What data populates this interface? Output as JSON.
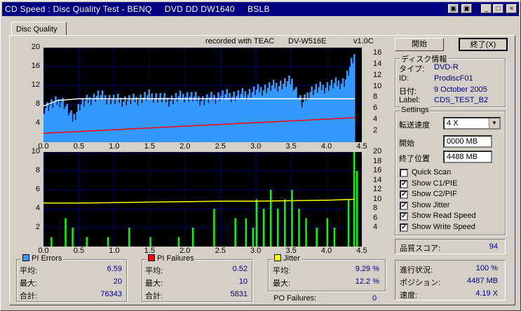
{
  "window": {
    "title": "CD Speed : Disc Quality Test - BENQ     DVD DD DW1640     BSLB",
    "title_buttons": [
      "▣",
      "▣",
      "_",
      "□",
      "×"
    ]
  },
  "tab": {
    "label": "Disc Quality"
  },
  "header": {
    "recorded": "recorded with TEAC",
    "drive": "DV-W516E",
    "version": "v1.0C"
  },
  "buttons": {
    "start": "開始",
    "exit": "終了(X)"
  },
  "disc_info": {
    "title": "ディスク情報",
    "type_label": "タイプ:",
    "type_value": "DVD-R",
    "id_label": "ID:",
    "id_value": "ProdiscF01",
    "date_label": "日付:",
    "date_value": "9 October 2005",
    "label_label": "Label:",
    "label_value": "CDS_TEST_B2"
  },
  "settings": {
    "title": "Settings",
    "speed_label": "転送速度",
    "speed_value": "4 X",
    "start_label": "開始",
    "start_value": "0000 MB",
    "end_label": "終了位置",
    "end_value": "4488 MB",
    "options": [
      {
        "label": "Quick Scan",
        "checked": false
      },
      {
        "label": "Show C1/PIE",
        "checked": true
      },
      {
        "label": "Show C2/PIF",
        "checked": true
      },
      {
        "label": "Show Jitter",
        "checked": true
      },
      {
        "label": "Show Read Speed",
        "checked": true
      },
      {
        "label": "Show Write Speed",
        "checked": true
      }
    ]
  },
  "quality": {
    "label": "品質スコア:",
    "value": "94"
  },
  "progress": {
    "status_label": "進行状況:",
    "status_value": "100 %",
    "position_label": "ポジション:",
    "position_value": "4487 MB",
    "speed_label": "速度:",
    "speed_value": "4.19 X"
  },
  "pi_errors": {
    "title": "PI Errors",
    "color": "#3399ff",
    "avg_label": "平均:",
    "avg": "6.59",
    "max_label": "最大:",
    "max": "20",
    "total_label": "合計:",
    "total": "76343"
  },
  "pi_failures": {
    "title": "PI Failures",
    "color": "#ff0000",
    "avg_label": "平均:",
    "avg": "0.52",
    "max_label": "最大:",
    "max": "10",
    "total_label": "合計:",
    "total": "5831"
  },
  "jitter": {
    "title": "Jitter",
    "color": "#ffff00",
    "avg_label": "平均:",
    "avg": "9.29 %",
    "max_label": "最大:",
    "max": "12.2 %"
  },
  "po_failures": {
    "label": "PO Failures:",
    "value": "0"
  },
  "chart_data": [
    {
      "type": "bar",
      "title": "",
      "x_ticks": [
        "0.0",
        "0.5",
        "1.0",
        "1.5",
        "2.0",
        "2.5",
        "3.0",
        "3.5",
        "4.0",
        "4.5"
      ],
      "xlim": [
        0,
        4.5
      ],
      "y_left_ticks": [
        "20",
        "16",
        "12",
        "8",
        "4"
      ],
      "ylim_left": [
        0,
        20
      ],
      "y_right_ticks": [
        "16",
        "14",
        "12",
        "10",
        "8",
        "6",
        "4",
        "2"
      ],
      "ylim_right": [
        0,
        17
      ],
      "series": [
        {
          "name": "PI Errors",
          "color": "#3399ff",
          "x": [
            0.0,
            0.25,
            0.4,
            0.5,
            0.75,
            1.0,
            1.25,
            1.5,
            1.75,
            2.0,
            2.25,
            2.5,
            2.75,
            3.0,
            3.25,
            3.5,
            3.65,
            3.75,
            4.0,
            4.25,
            4.4
          ],
          "values": [
            7.5,
            9,
            5,
            8,
            10,
            9,
            9,
            10,
            9,
            10,
            9,
            10,
            10,
            11,
            12,
            13,
            8,
            11,
            12,
            13,
            19
          ]
        },
        {
          "name": "Read Speed",
          "color": "#ffffff",
          "x": [
            0.0,
            0.1,
            0.2,
            0.5,
            1.0,
            1.5,
            2.0,
            2.5,
            3.0,
            3.5,
            4.0,
            4.4
          ],
          "values": [
            6.5,
            7,
            7.5,
            7.8,
            7.8,
            7.8,
            7.8,
            7.8,
            7.8,
            7.8,
            7.8,
            7.8
          ]
        },
        {
          "name": "Write Speed",
          "color": "#ff0000",
          "x": [
            0.0,
            4.4
          ],
          "values": [
            1.6,
            4.4
          ]
        }
      ]
    },
    {
      "type": "bar",
      "title": "",
      "x_ticks": [
        "0.0",
        "0.5",
        "1.0",
        "1.5",
        "2.0",
        "2.5",
        "3.0",
        "3.5",
        "4.0",
        "4.5"
      ],
      "xlim": [
        0,
        4.5
      ],
      "y_left_ticks": [
        "10",
        "8",
        "6",
        "4",
        "2"
      ],
      "ylim_left": [
        0,
        10
      ],
      "y_right_ticks": [
        "20",
        "18",
        "16",
        "14",
        "12",
        "10",
        "8",
        "6",
        "4"
      ],
      "ylim_right": [
        0,
        20
      ],
      "series": [
        {
          "name": "PI Failures",
          "color": "#00ff00",
          "x": [
            0.1,
            0.3,
            0.4,
            0.6,
            0.9,
            1.2,
            1.5,
            1.9,
            2.1,
            2.4,
            2.7,
            2.85,
            2.95,
            3.0,
            3.1,
            3.2,
            3.3,
            3.4,
            3.5,
            3.6,
            3.7,
            3.85,
            4.0,
            4.1,
            4.3,
            4.38,
            4.42
          ],
          "values": [
            1,
            3,
            2,
            1,
            1,
            2,
            1,
            1,
            2,
            4,
            3,
            3,
            2,
            5,
            4,
            6,
            4,
            5,
            6,
            4,
            3,
            2,
            3,
            2,
            5,
            10,
            8
          ]
        },
        {
          "name": "Jitter",
          "color": "#ffff00",
          "x": [
            0.0,
            0.5,
            1.0,
            1.5,
            2.0,
            2.5,
            3.0,
            3.5,
            4.0,
            4.4
          ],
          "values": [
            9.2,
            9.2,
            9.3,
            9.4,
            9.5,
            9.6,
            9.6,
            9.7,
            9.8,
            10
          ]
        }
      ]
    }
  ]
}
